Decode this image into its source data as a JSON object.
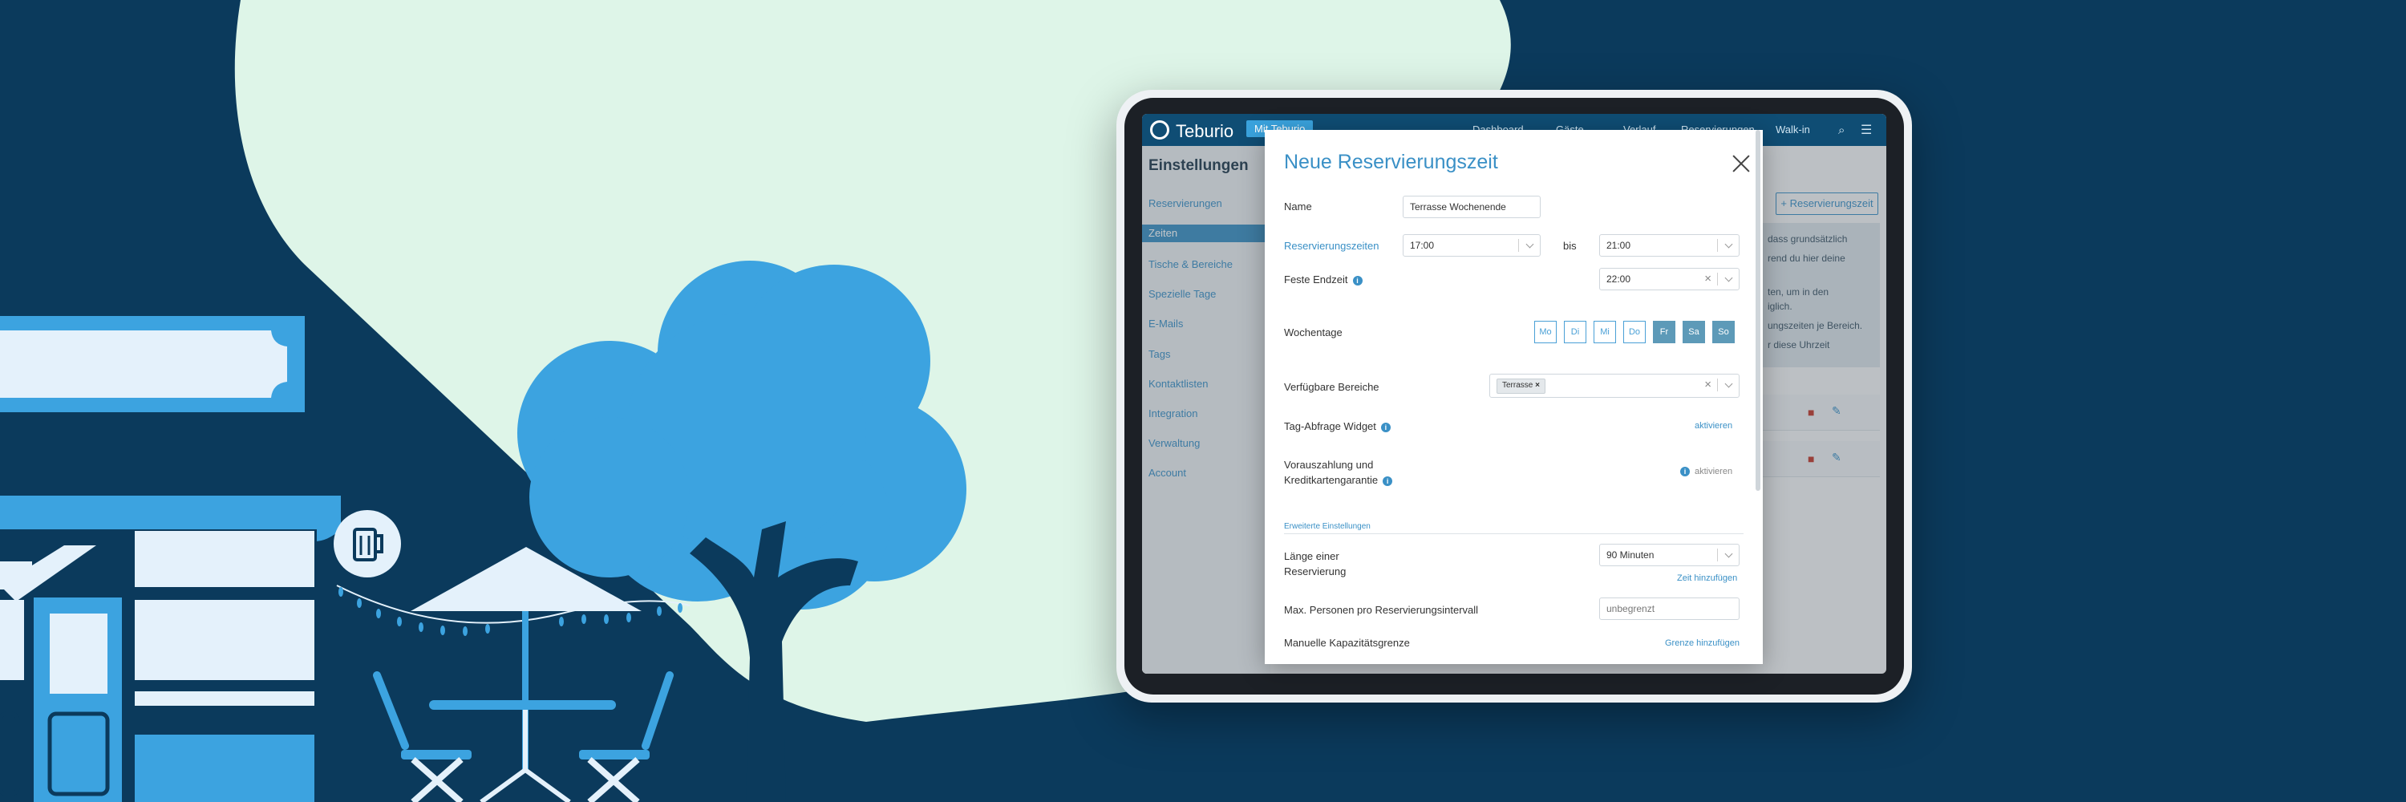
{
  "app": {
    "brand": "Teburio",
    "top_pill": "Mit Teburio",
    "nav": [
      "Dashboard",
      "Gäste",
      "Verlauf",
      "Reservierungen",
      "Walk-in"
    ]
  },
  "sidebar": {
    "title": "Einstellungen",
    "items": [
      "Reservierungen",
      "Zeiten",
      "Tische & Bereiche",
      "Spezielle Tage",
      "E-Mails",
      "Tags",
      "Kontaktlisten",
      "Integration",
      "Verwaltung",
      "Account"
    ],
    "active": "Zeiten"
  },
  "background": {
    "add_button": "+ Reservierungszeit",
    "info_lines": [
      "dass grundsätzlich",
      "rend du hier deine",
      "",
      "ten, um in den",
      "iglich.",
      "ungszeiten je Bereich.",
      "r diese Uhrzeit"
    ]
  },
  "modal": {
    "title": "Neue Reservierungszeit",
    "name_label": "Name",
    "name_value": "Terrasse Wochenende",
    "times_label": "Reservierungszeiten",
    "time_from": "17:00",
    "bis": "bis",
    "time_to": "21:00",
    "end_label": "Feste Endzeit",
    "end_value": "22:00",
    "weekdays_label": "Wochentage",
    "weekdays": [
      {
        "label": "Mo",
        "on": false
      },
      {
        "label": "Di",
        "on": false
      },
      {
        "label": "Mi",
        "on": false
      },
      {
        "label": "Do",
        "on": false
      },
      {
        "label": "Fr",
        "on": true
      },
      {
        "label": "Sa",
        "on": true
      },
      {
        "label": "So",
        "on": true
      }
    ],
    "areas_label": "Verfügbare Bereiche",
    "area_tag": "Terrasse",
    "widget_label": "Tag-Abfrage Widget",
    "widget_action": "aktivieren",
    "prepay_label_1": "Vorauszahlung und",
    "prepay_label_2": "Kreditkartengarantie",
    "prepay_action": "aktivieren",
    "section": "Erweiterte Einstellungen",
    "length_label_1": "Länge einer",
    "length_label_2": "Reservierung",
    "length_value": "90 Minuten",
    "add_time": "Zeit hinzufügen",
    "max_label": "Max. Personen pro Reservierungsintervall",
    "max_placeholder": "unbegrenzt",
    "cap_label": "Manuelle Kapazitätsgrenze",
    "cap_action": "Grenze hinzufügen"
  },
  "colors": {
    "bg": "#0b3a5c",
    "mint": "#def5e8",
    "blue": "#3ca3e0",
    "pale": "#e4f1fb",
    "accent": "#3a90c6"
  }
}
